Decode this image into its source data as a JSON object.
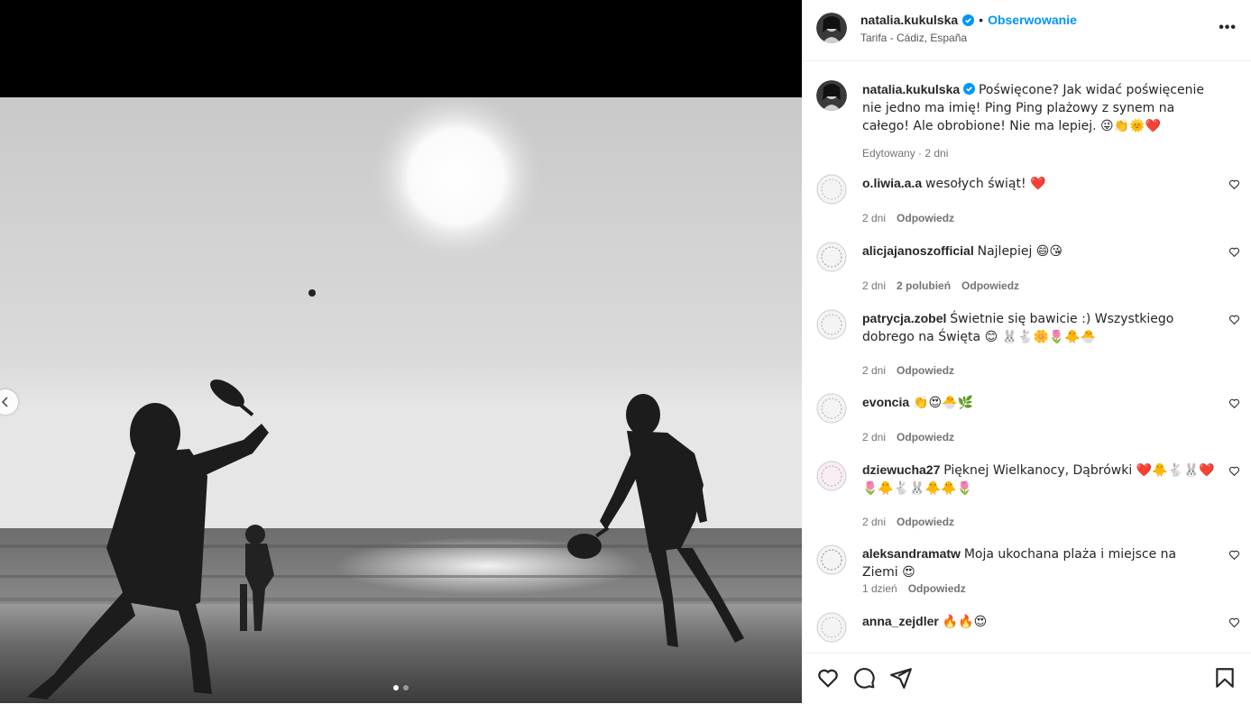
{
  "post": {
    "username": "natalia.kukulska",
    "follow_label": "Obserwowanie",
    "separator": "•",
    "location": "Tarifa - Cádiz, España",
    "more_label": "•••",
    "caption": "Poświęcone? Jak widać poświęcenie nie jedno ma imię! Ping Ping plażowy z synem na całego! Ale obrobione! Nie ma lepiej. 😜👏🌞❤️",
    "caption_meta": "Edytowany · 2 dni"
  },
  "comments": [
    {
      "user": "o.liwia.a.a",
      "text": "wesołych świąt! ❤️",
      "age": "2 dni",
      "likes": "",
      "reply": "Odpowiedz"
    },
    {
      "user": "alicjajanoszofficial",
      "text": "Najlepiej 😄😘",
      "age": "2 dni",
      "likes": "2 polubień",
      "reply": "Odpowiedz"
    },
    {
      "user": "patrycja.zobel",
      "text": "Świetnie się bawicie :) Wszystkiego dobrego na Święta 😊 🐰🐇🌼🌷🐥🐣",
      "age": "2 dni",
      "likes": "",
      "reply": "Odpowiedz"
    },
    {
      "user": "evoncia",
      "text": "👏😍🐣🌿",
      "age": "2 dni",
      "likes": "",
      "reply": "Odpowiedz"
    },
    {
      "user": "dziewucha27",
      "text": "Pięknej Wielkanocy, Dąbrówki ❤️🐥🐇🐰❤️🌷🐥🐇🐰🐥🐥🌷",
      "age": "2 dni",
      "likes": "",
      "reply": "Odpowiedz"
    },
    {
      "user": "aleksandramatw",
      "text": "Moja ukochana plaża i miejsce na Ziemi 😍",
      "age": "1 dzień",
      "likes": "",
      "reply": "Odpowiedz"
    },
    {
      "user": "anna_zejdler",
      "text": "🔥🔥😍",
      "age": "",
      "likes": "",
      "reply": ""
    }
  ],
  "colors": {
    "accent": "#0095f6",
    "verified": "#0095f6",
    "heart": "#ed1c24"
  },
  "icons": [
    "chevron-left-icon",
    "verified-badge-icon",
    "heart-icon",
    "comment-icon",
    "share-icon",
    "bookmark-icon"
  ]
}
